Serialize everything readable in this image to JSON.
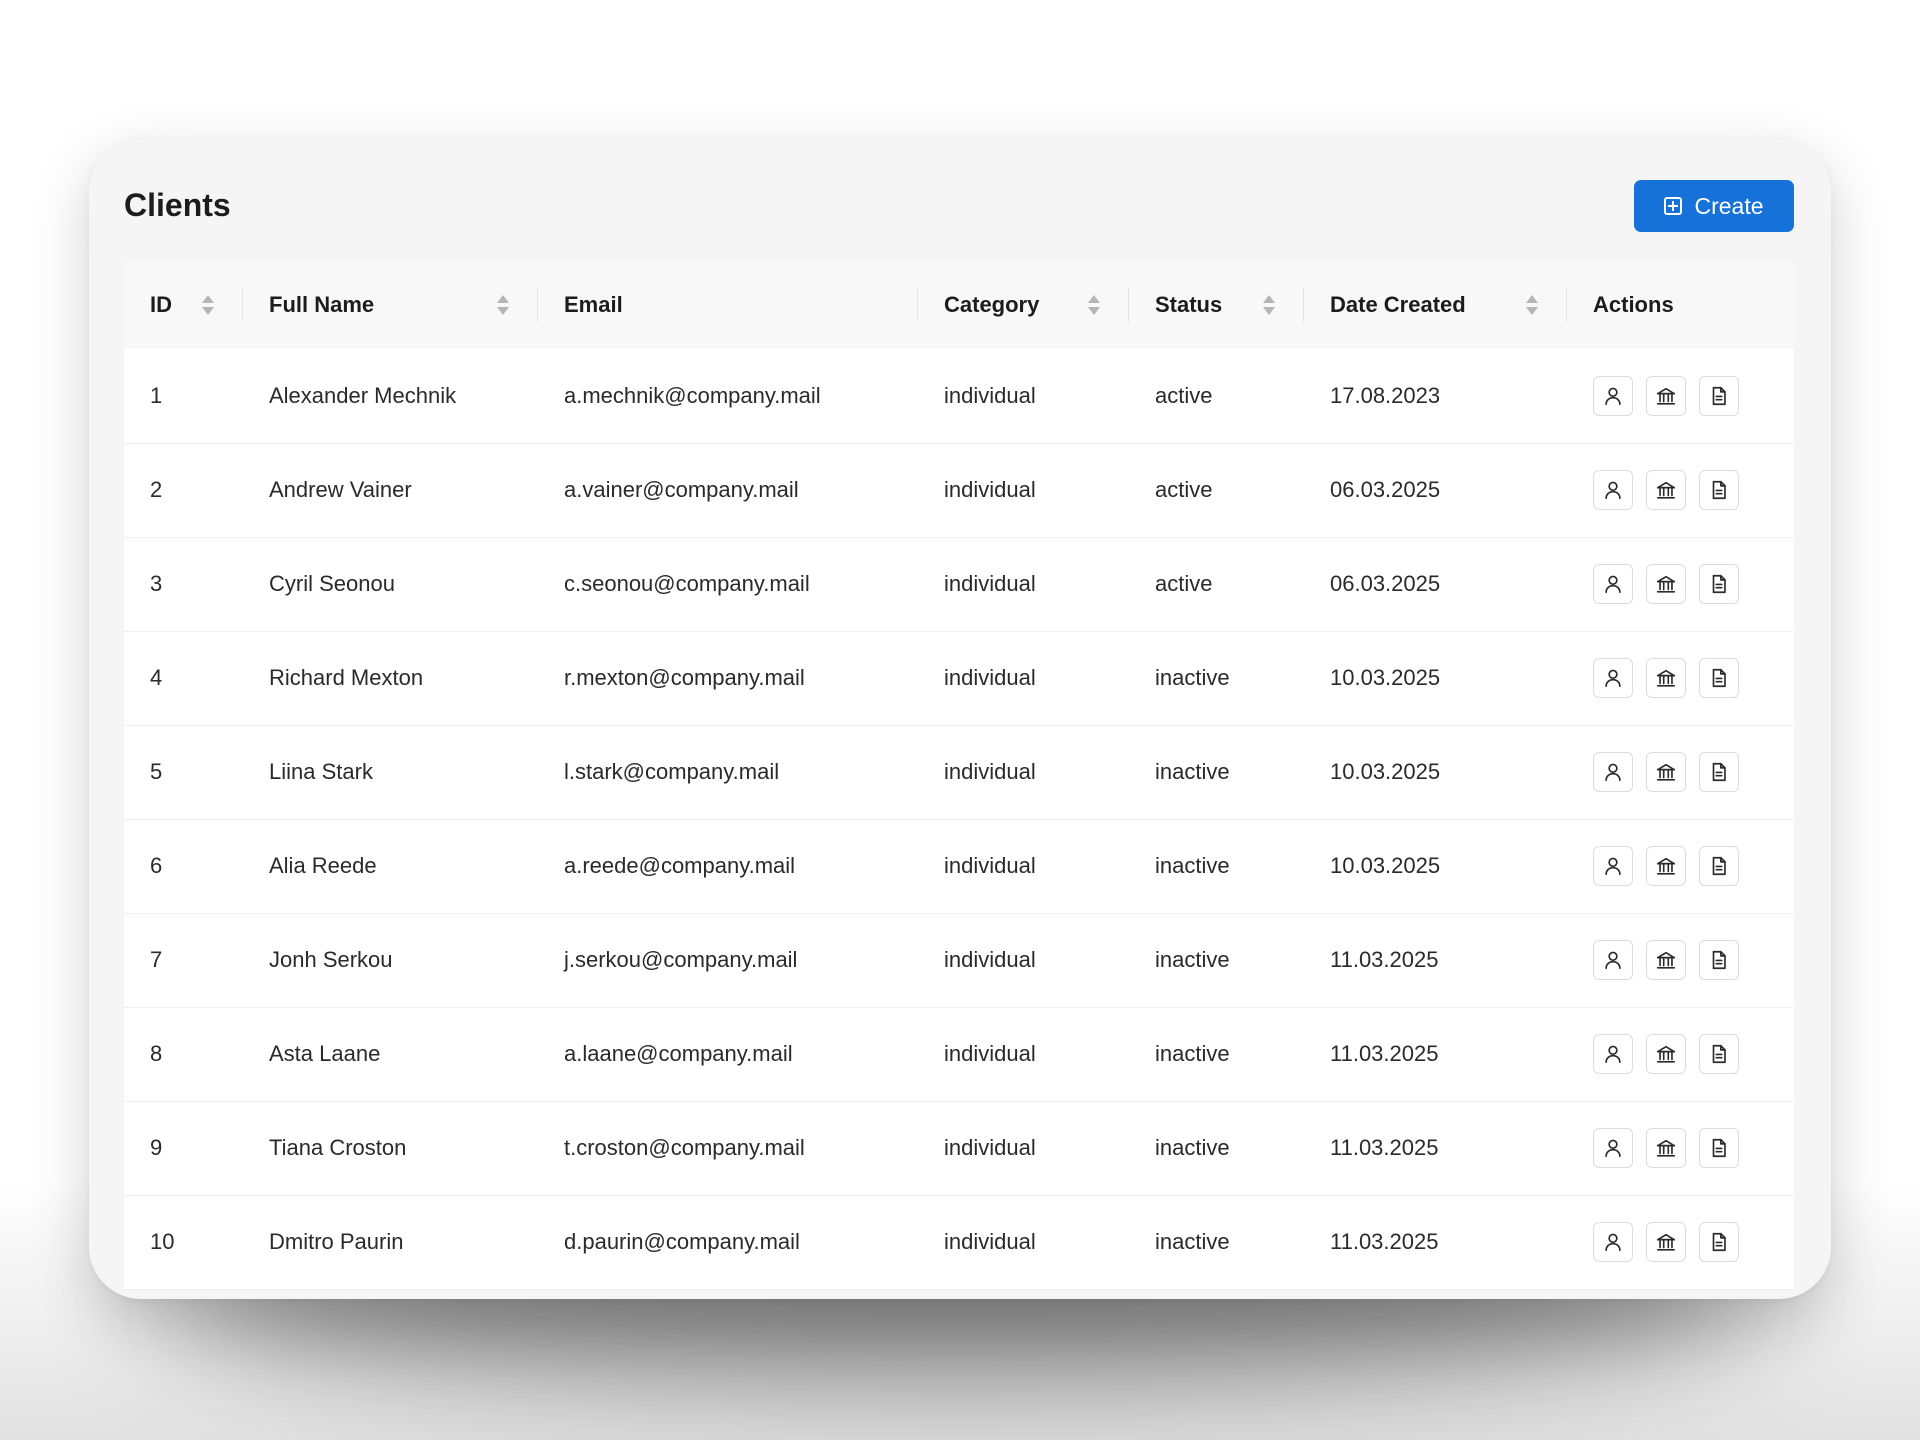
{
  "page": {
    "title": "Clients",
    "create_label": "Create"
  },
  "colors": {
    "accent": "#1671d9",
    "card_bg": "#f5f5f5",
    "header_bg": "#f8f8f8",
    "row_bg": "#ffffff"
  },
  "table": {
    "columns": [
      {
        "key": "id",
        "label": "ID",
        "sortable": true
      },
      {
        "key": "full_name",
        "label": "Full Name",
        "sortable": true
      },
      {
        "key": "email",
        "label": "Email",
        "sortable": false
      },
      {
        "key": "category",
        "label": "Category",
        "sortable": true
      },
      {
        "key": "status",
        "label": "Status",
        "sortable": true
      },
      {
        "key": "date_created",
        "label": "Date Created",
        "sortable": true
      },
      {
        "key": "actions",
        "label": "Actions",
        "sortable": false
      }
    ],
    "row_actions": [
      "user-icon",
      "bank-icon",
      "document-icon"
    ],
    "rows": [
      {
        "id": "1",
        "full_name": "Alexander Mechnik",
        "email": "a.mechnik@company.mail",
        "category": "individual",
        "status": "active",
        "date_created": "17.08.2023"
      },
      {
        "id": "2",
        "full_name": "Andrew Vainer",
        "email": "a.vainer@company.mail",
        "category": "individual",
        "status": "active",
        "date_created": "06.03.2025"
      },
      {
        "id": "3",
        "full_name": "Cyril Seonou",
        "email": "c.seonou@company.mail",
        "category": "individual",
        "status": "active",
        "date_created": "06.03.2025"
      },
      {
        "id": "4",
        "full_name": "Richard Mexton",
        "email": "r.mexton@company.mail",
        "category": "individual",
        "status": "inactive",
        "date_created": "10.03.2025"
      },
      {
        "id": "5",
        "full_name": "Liina Stark",
        "email": "l.stark@company.mail",
        "category": "individual",
        "status": "inactive",
        "date_created": "10.03.2025"
      },
      {
        "id": "6",
        "full_name": "Alia Reede",
        "email": "a.reede@company.mail",
        "category": "individual",
        "status": "inactive",
        "date_created": "10.03.2025"
      },
      {
        "id": "7",
        "full_name": "Jonh Serkou",
        "email": "j.serkou@company.mail",
        "category": "individual",
        "status": "inactive",
        "date_created": "11.03.2025"
      },
      {
        "id": "8",
        "full_name": "Asta Laane",
        "email": "a.laane@company.mail",
        "category": "individual",
        "status": "inactive",
        "date_created": "11.03.2025"
      },
      {
        "id": "9",
        "full_name": "Tiana Croston",
        "email": "t.croston@company.mail",
        "category": "individual",
        "status": "inactive",
        "date_created": "11.03.2025"
      },
      {
        "id": "10",
        "full_name": "Dmitro Paurin",
        "email": "d.paurin@company.mail",
        "category": "individual",
        "status": "inactive",
        "date_created": "11.03.2025"
      }
    ]
  }
}
